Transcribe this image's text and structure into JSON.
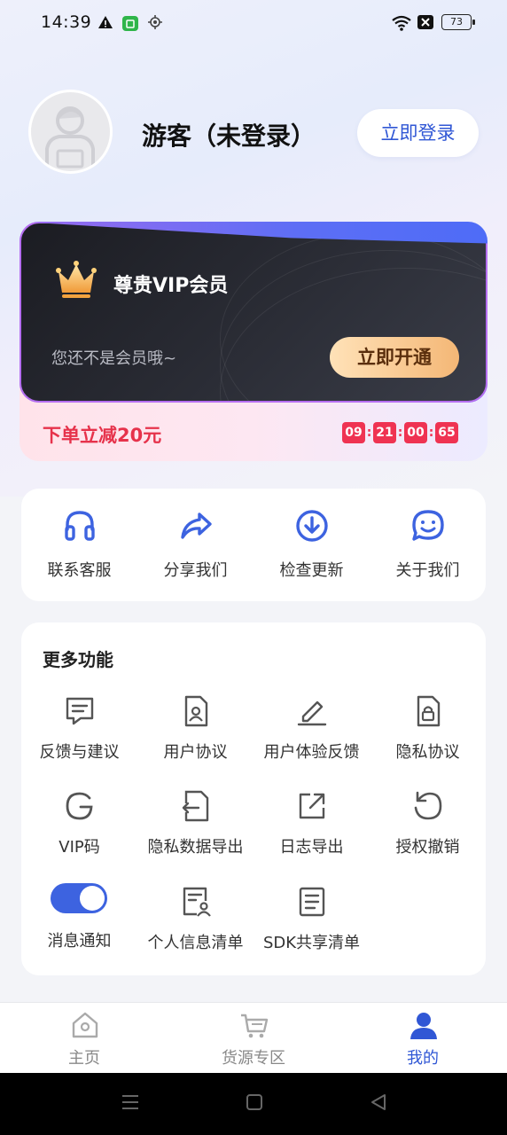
{
  "status_bar": {
    "time": "14:39",
    "battery": "73"
  },
  "profile": {
    "username": "游客（未登录）",
    "login_label": "立即登录"
  },
  "vip": {
    "title": "尊贵VIP会员",
    "subtitle": "您还不是会员哦~",
    "button_label": "立即开通",
    "promo": "下单立减20元",
    "countdown": [
      "09",
      "21",
      "00",
      "65"
    ]
  },
  "quick_actions": [
    {
      "label": "联系客服",
      "icon": "headset-icon"
    },
    {
      "label": "分享我们",
      "icon": "share-icon"
    },
    {
      "label": "检查更新",
      "icon": "download-icon"
    },
    {
      "label": "关于我们",
      "icon": "smile-icon"
    }
  ],
  "more": {
    "title": "更多功能",
    "items": [
      {
        "label": "反馈与建议",
        "icon": "feedback-icon"
      },
      {
        "label": "用户协议",
        "icon": "user-agreement-icon"
      },
      {
        "label": "用户体验反馈",
        "icon": "edit-icon"
      },
      {
        "label": "隐私协议",
        "icon": "privacy-lock-icon"
      },
      {
        "label": "VIP码",
        "icon": "g-icon"
      },
      {
        "label": "隐私数据导出",
        "icon": "export-icon"
      },
      {
        "label": "日志导出",
        "icon": "external-link-icon"
      },
      {
        "label": "授权撤销",
        "icon": "undo-icon"
      },
      {
        "label": "消息通知",
        "icon": "toggle-switch",
        "toggle_on": true
      },
      {
        "label": "个人信息清单",
        "icon": "personal-info-icon"
      },
      {
        "label": "SDK共享清单",
        "icon": "list-icon"
      }
    ]
  },
  "bottom_nav": [
    {
      "label": "主页",
      "icon": "home-icon",
      "active": false
    },
    {
      "label": "货源专区",
      "icon": "cart-icon",
      "active": false
    },
    {
      "label": "我的",
      "icon": "user-icon",
      "active": true
    }
  ],
  "colors": {
    "accent": "#3057d5",
    "icon_blue": "#3d63e0",
    "promo_red": "#e6324b",
    "vip_gold": "#f4b776"
  }
}
